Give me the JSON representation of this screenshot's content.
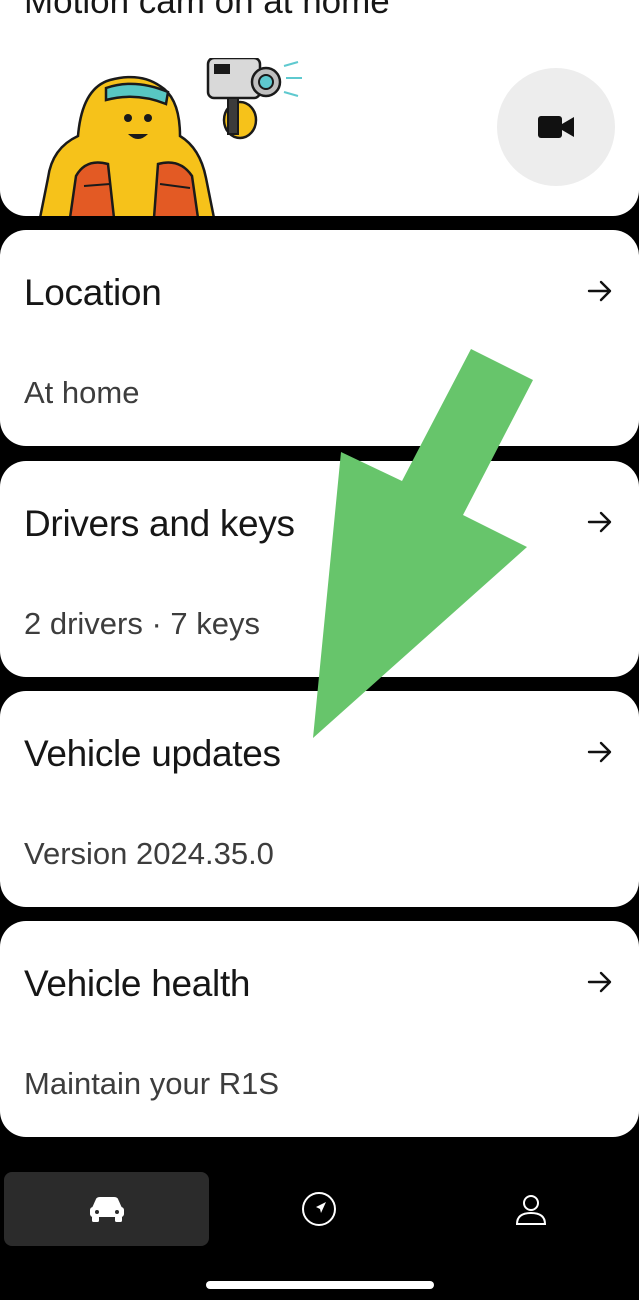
{
  "top_card": {
    "title": "Motion cam on at home",
    "camera_icon": "video-camera-icon"
  },
  "cards": [
    {
      "title": "Location",
      "subtitle": "At home",
      "icon": "arrow-right-icon"
    },
    {
      "title": "Drivers and keys",
      "subtitle": "2 drivers · 7 keys",
      "icon": "arrow-right-icon"
    },
    {
      "title": "Vehicle updates",
      "subtitle": "Version 2024.35.0",
      "icon": "arrow-right-icon"
    },
    {
      "title": "Vehicle health",
      "subtitle": "Maintain your R1S",
      "icon": "arrow-right-icon"
    }
  ],
  "nav": {
    "items": [
      {
        "icon": "car-icon",
        "active": true
      },
      {
        "icon": "navigation-icon",
        "active": false
      },
      {
        "icon": "profile-icon",
        "active": false
      }
    ]
  },
  "colors": {
    "background": "#000000",
    "card": "#ffffff",
    "annotation_arrow": "#67c56b"
  }
}
